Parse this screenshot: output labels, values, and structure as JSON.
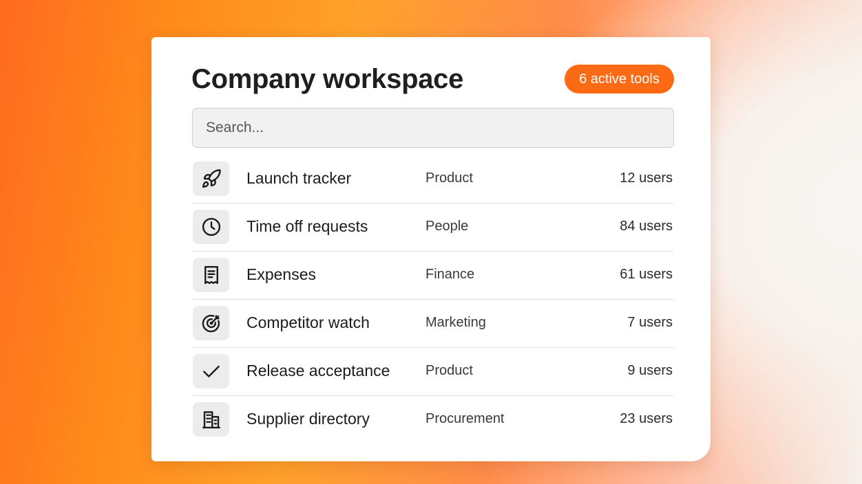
{
  "header": {
    "title": "Company workspace",
    "badge": "6 active tools"
  },
  "search": {
    "placeholder": "Search..."
  },
  "colors": {
    "accent": "#fd6a14",
    "icon_tile": "#ececec"
  },
  "tools": [
    {
      "name": "Launch tracker",
      "department": "Product",
      "users": "12 users",
      "icon": "rocket-icon"
    },
    {
      "name": "Time off requests",
      "department": "People",
      "users": "84 users",
      "icon": "clock-icon"
    },
    {
      "name": "Expenses",
      "department": "Finance",
      "users": "61 users",
      "icon": "receipt-icon"
    },
    {
      "name": "Competitor watch",
      "department": "Marketing",
      "users": "7 users",
      "icon": "target-icon"
    },
    {
      "name": "Release acceptance",
      "department": "Product",
      "users": "9 users",
      "icon": "checkmark-icon"
    },
    {
      "name": "Supplier directory",
      "department": "Procurement",
      "users": "23 users",
      "icon": "building-icon"
    }
  ]
}
